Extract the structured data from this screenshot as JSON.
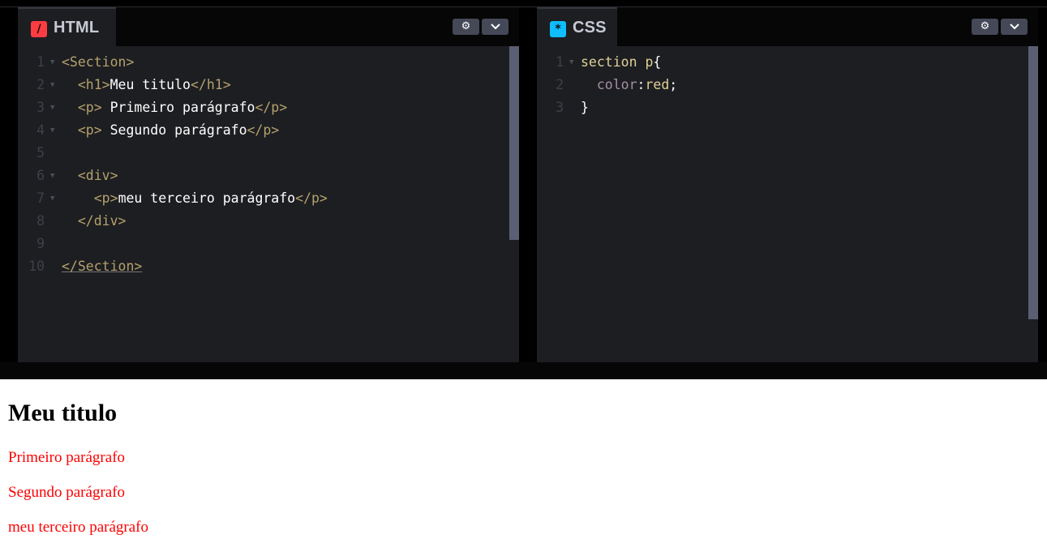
{
  "html_editor": {
    "tab_label": "HTML",
    "icon": "html-slash-icon",
    "icon_glyph": "/",
    "icon_color": "#ff3c41",
    "gear_button": "gear-icon",
    "chevron_button": "chevron-down-icon",
    "line_numbers": [
      "1",
      "2",
      "3",
      "4",
      "5",
      "6",
      "7",
      "8",
      "9",
      "10"
    ],
    "lines": [
      {
        "open": "<Section>"
      },
      {
        "indent": "  ",
        "open": "<h1>",
        "text": "Meu titulo",
        "close": "</h1>"
      },
      {
        "indent": "  ",
        "open": "<p>",
        "text": " Primeiro parágrafo",
        "close": "</p>"
      },
      {
        "indent": "  ",
        "open": "<p>",
        "text": " Segundo parágrafo",
        "close": "</p>"
      },
      {},
      {
        "indent": "  ",
        "open": "<div>"
      },
      {
        "indent": "    ",
        "open": "<p>",
        "text": "meu terceiro parágrafo",
        "close": "</p>"
      },
      {
        "indent": "  ",
        "open": "</div>"
      },
      {},
      {
        "open": "</Section>"
      }
    ]
  },
  "css_editor": {
    "tab_label": "CSS",
    "icon": "css-asterisk-icon",
    "icon_glyph": "*",
    "icon_color": "#0ebeff",
    "line_numbers": [
      "1",
      "2",
      "3"
    ],
    "lines": [
      {
        "selector": "section p",
        "brace": "{"
      },
      {
        "indent": "  ",
        "prop": "color",
        "colon": ":",
        "value": "red",
        "semi": ";"
      },
      {
        "brace": "}"
      }
    ]
  },
  "preview": {
    "heading": "Meu titulo",
    "paragraphs": [
      "Primeiro parágrafo",
      "Segundo parágrafo",
      "meu terceiro parágrafo"
    ],
    "paragraph_color": "#ff0000"
  }
}
